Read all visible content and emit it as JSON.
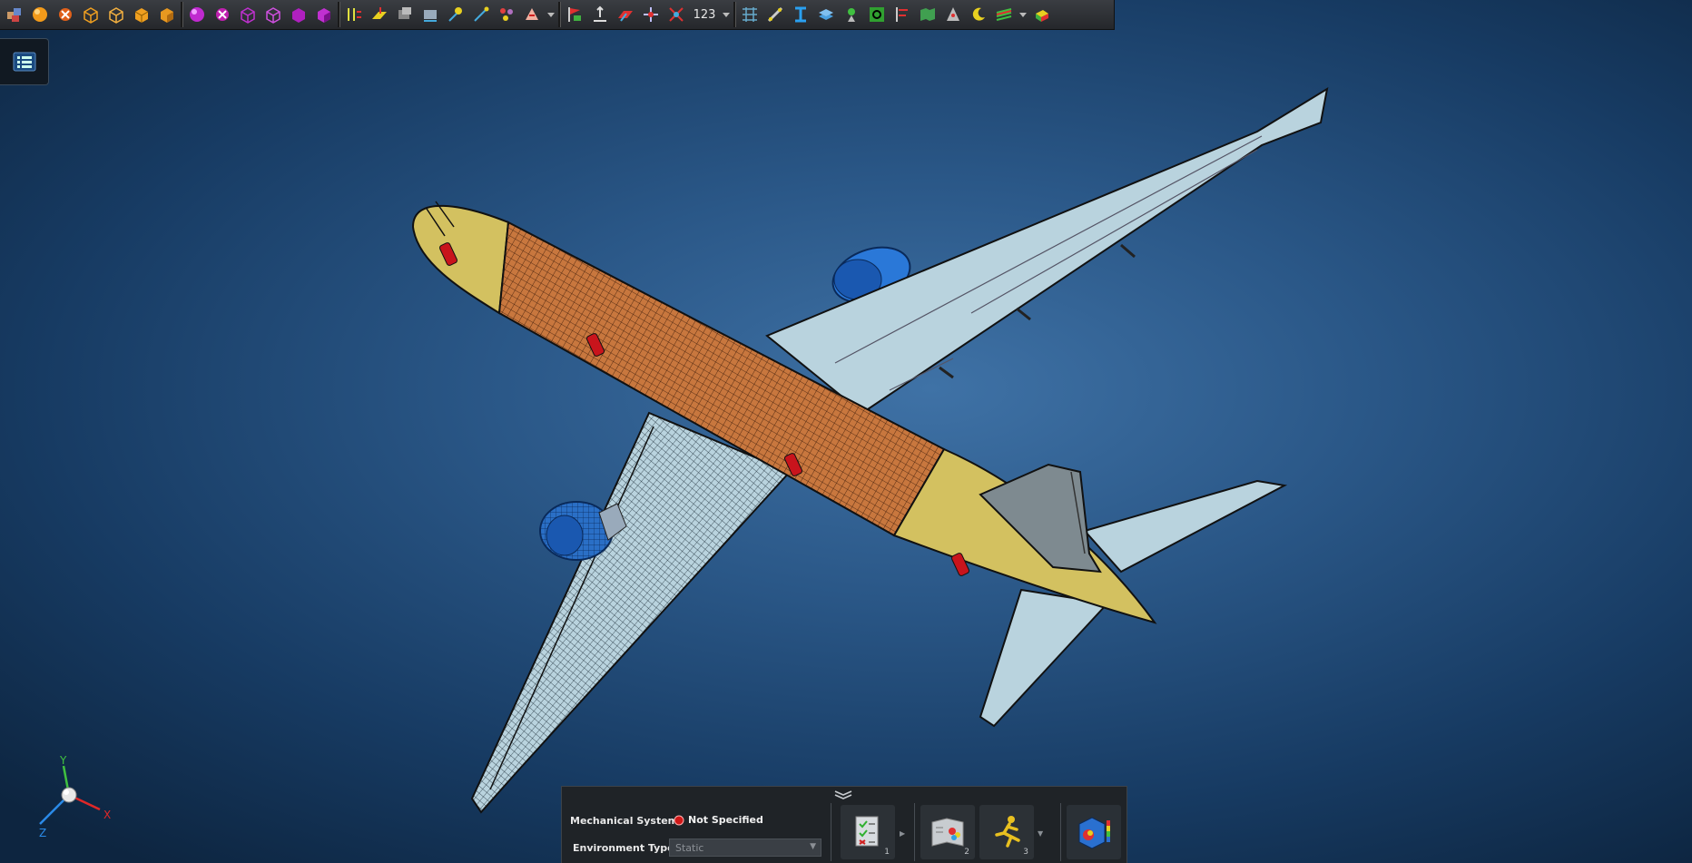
{
  "toolbar": {
    "counter_label": "123"
  },
  "panel": {
    "mechanical_system_label": "Mechanical System:",
    "mechanical_system_value": "Not Specified",
    "environment_type_label": "Environment Type:",
    "environment_type_value": "Static",
    "steps": [
      {
        "number": "1",
        "icon": "checklist-icon"
      },
      {
        "number": "2",
        "icon": "color-book-icon"
      },
      {
        "number": "3",
        "icon": "running-man-icon"
      }
    ]
  },
  "compass": {
    "axis_x": "X",
    "axis_y": "Y",
    "axis_z": "Z"
  },
  "colors": {
    "background_center": "#3f72a6",
    "background_edge": "#0d2540",
    "fuselage_mesh": "#c8773e",
    "fuselage_end": "#d3c160",
    "wing": "#b9d3de",
    "engine": "#2a6fc6",
    "door": "#c8141c"
  }
}
